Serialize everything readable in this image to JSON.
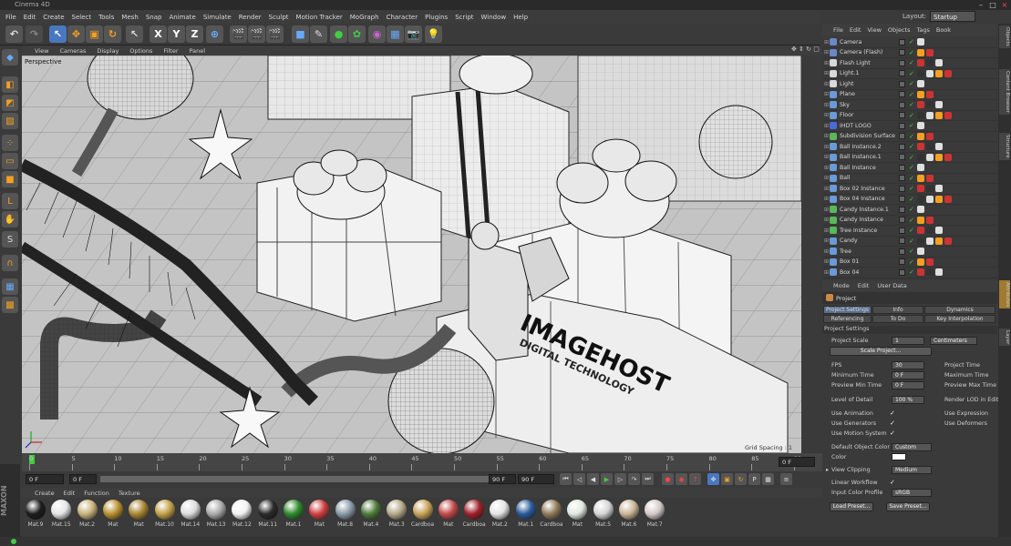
{
  "app": {
    "title": "Cinema 4D"
  },
  "menu": [
    "File",
    "Edit",
    "Create",
    "Select",
    "Tools",
    "Mesh",
    "Snap",
    "Animate",
    "Simulate",
    "Render",
    "Sculpt",
    "Motion Tracker",
    "MoGraph",
    "Character",
    "Plugins",
    "Script",
    "Window",
    "Help"
  ],
  "layout": {
    "label": "Layout:",
    "value": "Startup"
  },
  "viewport": {
    "menu": [
      "View",
      "Cameras",
      "Display",
      "Options",
      "Filter",
      "Panel"
    ],
    "label": "Perspective",
    "grid_spacing": "Grid Spacing : 1",
    "logo_line1": "IMAGEHOST",
    "logo_line2": "DIGITAL TECHNOLOGY"
  },
  "timeline": {
    "ticks": [
      "0",
      "5",
      "10",
      "15",
      "20",
      "25",
      "30",
      "35",
      "40",
      "45",
      "50",
      "55",
      "60",
      "65",
      "70",
      "75",
      "80",
      "85",
      "90"
    ],
    "current": "0 F",
    "start": "0 F",
    "end_a": "90 F",
    "end_b": "90 F",
    "frame_field": "0 F"
  },
  "materials": {
    "menu": [
      "Create",
      "Edit",
      "Function",
      "Texture"
    ],
    "items": [
      {
        "label": "Mat.9",
        "color": "#1c1c1c"
      },
      {
        "label": "Mat.15",
        "color": "#e6e6e6"
      },
      {
        "label": "Mat.2",
        "color": "#c9b27a"
      },
      {
        "label": "Mat",
        "color": "#b8902f"
      },
      {
        "label": "Mat",
        "color": "#a88632"
      },
      {
        "label": "Mat.10",
        "color": "#c2a04a"
      },
      {
        "label": "Mat.14",
        "color": "#dcdcdc"
      },
      {
        "label": "Mat.13",
        "color": "#aaaaaa"
      },
      {
        "label": "Mat.12",
        "color": "#f2f2f2"
      },
      {
        "label": "Mat.11",
        "color": "#2a2a2a"
      },
      {
        "label": "Mat.1",
        "color": "#2e8a2e"
      },
      {
        "label": "Mat",
        "color": "#d04040"
      },
      {
        "label": "Mat.8",
        "color": "#8a9aa8"
      },
      {
        "label": "Mat.4",
        "color": "#4f7a3a"
      },
      {
        "label": "Mat.3",
        "color": "#b5a98a"
      },
      {
        "label": "Cardboa",
        "color": "#c7a35a"
      },
      {
        "label": "Mat",
        "color": "#c24a4a"
      },
      {
        "label": "Cardboa",
        "color": "#a0202a"
      },
      {
        "label": "Mat.2",
        "color": "#e4e4e4"
      },
      {
        "label": "Mat.1",
        "color": "#2a5a9a"
      },
      {
        "label": "Cardboa",
        "color": "#8f7a5a"
      },
      {
        "label": "Mat",
        "color": "#e0e8e0"
      },
      {
        "label": "Mat.5",
        "color": "#d6d6d6"
      },
      {
        "label": "Mat.6",
        "color": "#c9b596"
      },
      {
        "label": "Mat.7",
        "color": "#d6c9c9"
      }
    ]
  },
  "objects": {
    "menu": [
      "File",
      "Edit",
      "View",
      "Objects",
      "Tags",
      "Book"
    ],
    "rows": [
      {
        "name": "Camera",
        "color": "#6a88c8"
      },
      {
        "name": "Camera (Flash)",
        "color": "#6a88c8"
      },
      {
        "name": "Flash Light",
        "color": "#d8d8d8"
      },
      {
        "name": "Light.1",
        "color": "#d8d8d8"
      },
      {
        "name": "Light",
        "color": "#d8d8d8"
      },
      {
        "name": "Plane",
        "color": "#6a9ad8"
      },
      {
        "name": "Sky",
        "color": "#6a9ad8"
      },
      {
        "name": "Floor",
        "color": "#6a9ad8"
      },
      {
        "name": "IHDT LOGO",
        "color": "#4a6ad8"
      },
      {
        "name": "Subdivision Surface",
        "color": "#5ab85a"
      },
      {
        "name": "Ball Instance.2",
        "color": "#6a9ad8"
      },
      {
        "name": "Ball Instance.1",
        "color": "#6a9ad8"
      },
      {
        "name": "Ball Instance",
        "color": "#6a9ad8"
      },
      {
        "name": "Ball",
        "color": "#6a9ad8"
      },
      {
        "name": "Box 02 Instance",
        "color": "#6a9ad8"
      },
      {
        "name": "Box 04 Instance",
        "color": "#6a9ad8"
      },
      {
        "name": "Candy Instance.1",
        "color": "#5ab85a"
      },
      {
        "name": "Candy Instance",
        "color": "#5ab85a"
      },
      {
        "name": "Tree Instance",
        "color": "#5ab85a"
      },
      {
        "name": "Candy",
        "color": "#6a9ad8"
      },
      {
        "name": "Tree",
        "color": "#6a9ad8"
      },
      {
        "name": "Box 01",
        "color": "#6a9ad8"
      },
      {
        "name": "Box 04",
        "color": "#6a9ad8"
      }
    ]
  },
  "attributes": {
    "menu": [
      "Mode",
      "Edit",
      "User Data"
    ],
    "title": "Project",
    "tabs": [
      "Project Settings",
      "Info",
      "Dynamics",
      "Referencing",
      "To Do",
      "Key Interpolation"
    ],
    "section": "Project Settings",
    "project_scale_label": "Project Scale",
    "project_scale_value": "1",
    "project_scale_unit": "Centimeters",
    "scale_project_button": "Scale Project...",
    "fps_label": "FPS",
    "fps_value": "30",
    "project_time_label": "Project Time",
    "min_time_label": "Minimum Time",
    "min_time_value": "0 F",
    "max_time_label": "Maximum Time",
    "preview_min_label": "Preview Min Time",
    "preview_min_value": "0 F",
    "preview_max_label": "Preview Max Time",
    "lod_label": "Level of Detail",
    "lod_value": "100 %",
    "render_lod_label": "Render LOD in Editor",
    "use_animation": "Use Animation",
    "use_expression": "Use Expression",
    "use_generators": "Use Generators",
    "use_deformers": "Use Deformers",
    "use_motion": "Use Motion System",
    "default_color_label": "Default Object Color",
    "default_color_value": "Custom",
    "color_label": "Color",
    "view_clipping_label": "View Clipping",
    "view_clipping_value": "Medium",
    "linear_workflow_label": "Linear Workflow",
    "input_color_label": "Input Color Profile",
    "input_color_value": "sRGB",
    "load_preset": "Load Preset...",
    "save_preset": "Save Preset..."
  },
  "sidetabs": [
    "Objects",
    "Content Browser",
    "Structure",
    "Attributes",
    "Layer"
  ]
}
